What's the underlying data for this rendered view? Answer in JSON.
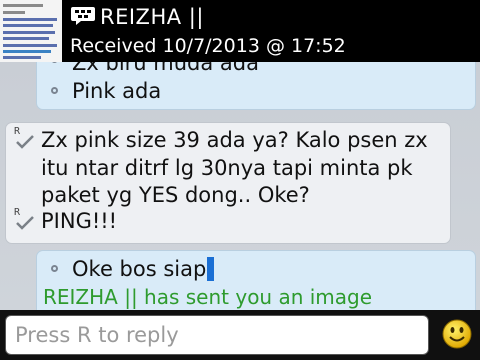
{
  "header": {
    "contact_name": "REIZHA ||",
    "received_text": "Received 10/7/2013 @ 17:52"
  },
  "messages": {
    "m1": {
      "lines": [
        "Zx biru muda ada",
        "Pink ada"
      ]
    },
    "m2": {
      "lines": [
        "Zx pink size 39 ada ya? Kalo psen zx",
        "itu ntar ditrf lg 30nya tapi minta pk",
        "paket yg YES dong.. Oke?",
        "PING!!!"
      ],
      "status_mark": "R"
    },
    "m3": {
      "lines": [
        "Oke bos siap"
      ],
      "system_note": "REIZHA || has sent you an image"
    }
  },
  "reply": {
    "placeholder": "Press R to reply"
  },
  "colors": {
    "header_bg": "#000000",
    "system_note": "#2e9b2e",
    "cursor": "#1a6fd4"
  },
  "icons": [
    "bbm-icon",
    "delivered-check-icon",
    "emoticon-smiley-icon"
  ]
}
